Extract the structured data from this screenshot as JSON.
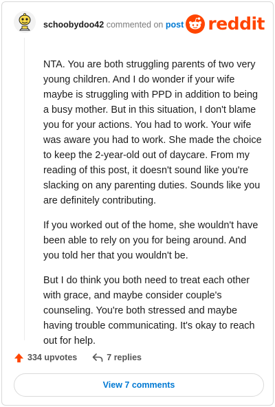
{
  "header": {
    "username": "schoobydoo42",
    "action_text": "commented on",
    "post_link_text": "post",
    "brand": "reddit"
  },
  "comment": {
    "paragraphs": [
      "NTA. You are both struggling parents of two very young children. And I do wonder if your wife maybe is struggling with PPD in addition to being a busy mother. But in this situation, I don't blame you for your actions. You had to work. Your wife was aware you had to work. She made the choice to keep the 2-year-old out of daycare. From my reading of this post, it doesn't sound like you're slacking on any parenting duties. Sounds like you are definitely contributing.",
      "If you worked out of the home, she wouldn't have been able to rely on you for being around. And you told her that you wouldn't be.",
      "But I do think you both need to treat each other with grace, and maybe consider couple's counseling. You're both stressed and maybe having trouble communicating. It's okay to reach out for help."
    ]
  },
  "actions": {
    "upvotes_label": "334 upvotes",
    "replies_label": "7 replies"
  },
  "footer": {
    "view_comments_label": "View 7 comments"
  },
  "colors": {
    "brand_orange": "#ff4500",
    "link_blue": "#0079d3"
  },
  "icons": {
    "avatar": "snoo-avatar",
    "logo": "reddit-snoo-icon",
    "upvote": "upvote-arrow-icon",
    "reply": "reply-arrow-icon"
  }
}
